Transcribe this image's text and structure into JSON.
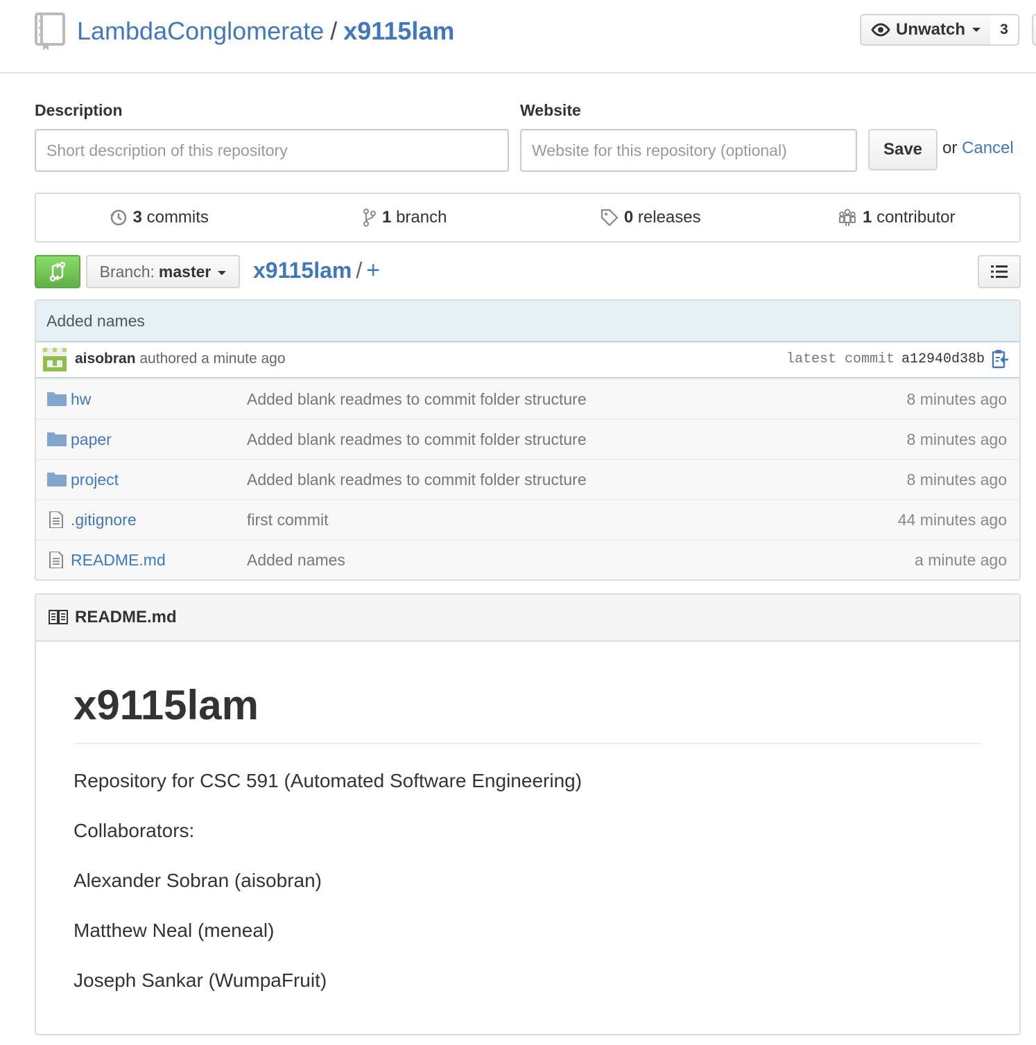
{
  "header": {
    "owner": "LambdaConglomerate",
    "separator": "/",
    "repo": "x9115lam",
    "watch_label": "Unwatch",
    "watch_count": "3"
  },
  "edit": {
    "description_label": "Description",
    "description_placeholder": "Short description of this repository",
    "description_value": "",
    "website_label": "Website",
    "website_placeholder": "Website for this repository (optional)",
    "website_value": "",
    "save_label": "Save",
    "or_text": "or",
    "cancel_label": "Cancel"
  },
  "summary": {
    "commits": {
      "count": "3",
      "label": "commits"
    },
    "branches": {
      "count": "1",
      "label": "branch"
    },
    "releases": {
      "count": "0",
      "label": "releases"
    },
    "contributors": {
      "count": "1",
      "label": "contributor"
    }
  },
  "nav": {
    "branch_prefix": "Branch:",
    "branch_name": "master",
    "path_root": "x9115lam",
    "path_sep": "/",
    "add_symbol": "+"
  },
  "commit": {
    "message": "Added names",
    "author": "aisobran",
    "authored_text": "authored a minute ago",
    "sha_label": "latest commit",
    "sha": "a12940d38b"
  },
  "files": [
    {
      "name": "hw",
      "type": "folder",
      "message": "Added blank readmes to commit folder structure",
      "age": "8 minutes ago"
    },
    {
      "name": "paper",
      "type": "folder",
      "message": "Added blank readmes to commit folder structure",
      "age": "8 minutes ago"
    },
    {
      "name": "project",
      "type": "folder",
      "message": "Added blank readmes to commit folder structure",
      "age": "8 minutes ago"
    },
    {
      "name": ".gitignore",
      "type": "file",
      "message": "first commit",
      "age": "44 minutes ago"
    },
    {
      "name": "README.md",
      "type": "file",
      "message": "Added names",
      "age": "a minute ago"
    }
  ],
  "readme": {
    "filename": "README.md",
    "title": "x9115lam",
    "paragraphs": [
      "Repository for CSC 591 (Automated Software Engineering)",
      "Collaborators:",
      "Alexander Sobran (aisobran)",
      "Matthew Neal (meneal)",
      "Joseph Sankar (WumpaFruit)"
    ]
  },
  "colors": {
    "link": "#4078c0",
    "commit_tease_bg": "#e6f1f6",
    "compare_button": "#60b044",
    "avatar_green": "#8fbf4b"
  },
  "icons": {
    "repo": "repo-icon",
    "watch": "eye-icon",
    "commits": "history-icon",
    "branch": "git-branch-icon",
    "releases": "tag-icon",
    "contributors": "organization-icon",
    "compare": "compare-icon",
    "list": "list-icon",
    "clipboard": "clipboard-icon",
    "folder": "folder-icon",
    "file": "file-text-icon",
    "book": "book-icon"
  }
}
